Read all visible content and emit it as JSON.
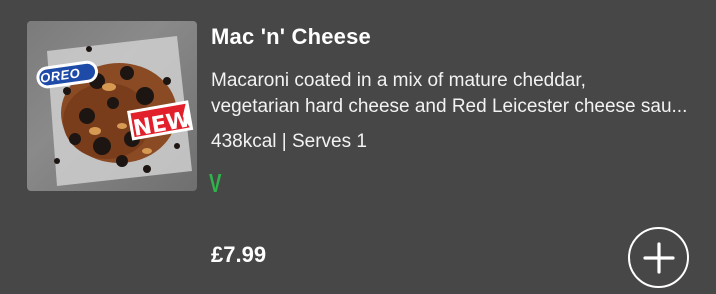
{
  "product": {
    "title": "Mac 'n' Cheese",
    "description_line1": "Macaroni coated in a mix of mature cheddar,",
    "description_line2": "vegetarian hard cheese and Red Leicester cheese sau...",
    "meta": "438kcal | Serves 1",
    "veg_mark": "V",
    "price": "£7.99",
    "image": {
      "brand_logo": "OREO",
      "badge": "NEW",
      "badge_color": "#e2202c",
      "logo_color": "#1e4aa8"
    }
  },
  "actions": {
    "add_icon": "plus-icon"
  },
  "colors": {
    "background": "#474747",
    "veg": "#2fb34a",
    "text": "#ffffff"
  }
}
